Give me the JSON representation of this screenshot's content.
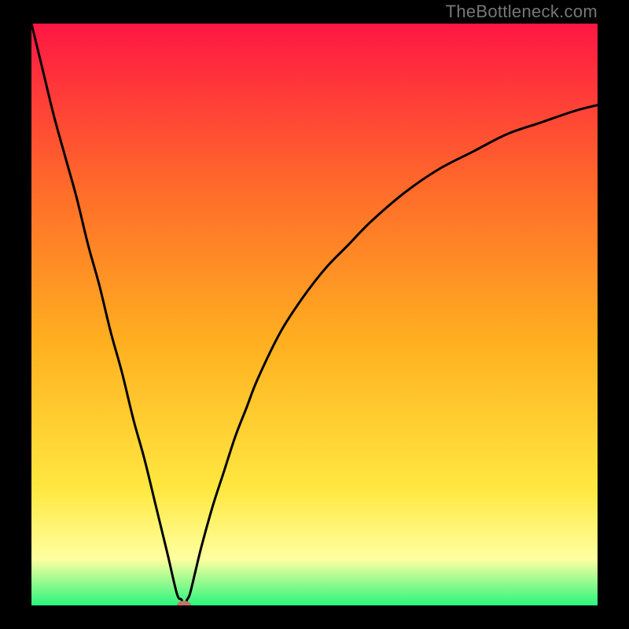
{
  "watermark": "TheBottleneck.com",
  "colors": {
    "gradient_top": "#ff1744",
    "gradient_upper_mid": "#ff6a2a",
    "gradient_mid": "#ffb020",
    "gradient_lower_mid": "#ffe840",
    "gradient_pale_yellow": "#ffffa0",
    "gradient_bottom": "#2bf57e",
    "curve": "#000000",
    "marker": "#c57366",
    "frame": "#000000"
  },
  "chart_data": {
    "type": "line",
    "title": "",
    "xlabel": "",
    "ylabel": "",
    "xlim": [
      0,
      100
    ],
    "ylim": [
      0,
      100
    ],
    "x": [
      0,
      2,
      4,
      6,
      8,
      10,
      12,
      14,
      16,
      18,
      20,
      22,
      24,
      25.7,
      26.5,
      27,
      27.5,
      28,
      29,
      30,
      32,
      34,
      36,
      38,
      40,
      44,
      48,
      52,
      56,
      60,
      66,
      72,
      78,
      84,
      90,
      96,
      100
    ],
    "y": [
      100,
      92,
      84,
      77,
      70,
      62,
      55,
      47,
      40,
      32,
      25,
      17,
      9,
      2,
      1,
      0,
      1,
      2,
      6,
      10,
      17,
      23,
      29,
      34,
      39,
      47,
      53,
      58,
      62,
      66,
      71,
      75,
      78,
      81,
      83,
      85,
      86
    ],
    "marker": {
      "x": 27,
      "y": 0
    }
  }
}
